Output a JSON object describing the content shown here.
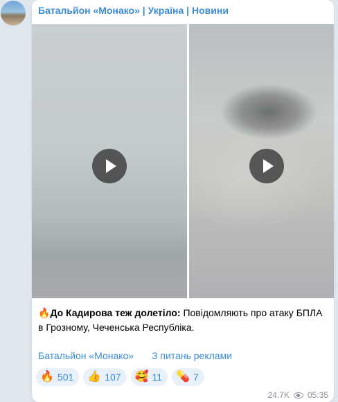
{
  "channel": {
    "name": "Батальйон «Монако» | Україна | Новини"
  },
  "media": {
    "videos": [
      {
        "label": "video-1"
      },
      {
        "label": "video-2"
      }
    ]
  },
  "post": {
    "emoji": "🔥",
    "bold_text": "До Кадирова теж долетіло:",
    "text": " Повідомляють про атаку БПЛА в Грозному, Чеченська Республіка."
  },
  "links": {
    "channel_link": "Батальйон «Монако»",
    "ads_link": "З питань реклами"
  },
  "reactions": [
    {
      "emoji": "🔥",
      "count": "501"
    },
    {
      "emoji": "👍",
      "count": "107"
    },
    {
      "emoji": "🥰",
      "count": "11"
    },
    {
      "emoji": "💊",
      "count": "7"
    }
  ],
  "meta": {
    "views": "24.7K",
    "time": "05:35"
  },
  "colors": {
    "accent": "#3a8bd8",
    "reaction_bg": "#e8f1fa",
    "page_bg": "#dfe6ee"
  }
}
